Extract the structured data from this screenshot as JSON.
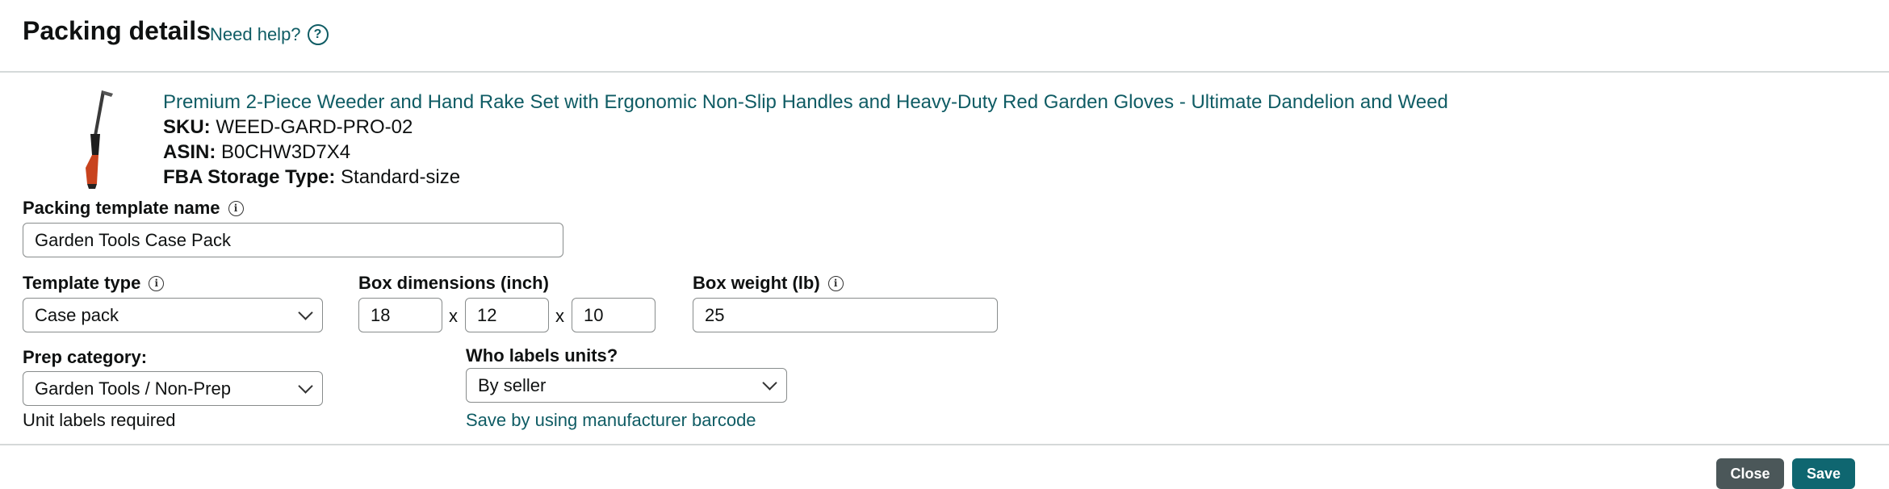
{
  "header": {
    "title": "Packing details",
    "help_label": "Need help?",
    "help_icon": "question-circle-icon"
  },
  "product": {
    "name": "Premium 2-Piece Weeder and Hand Rake Set with Ergonomic Non-Slip Handles and Heavy-Duty Red Garden Gloves - Ultimate Dandelion and Weed",
    "sku_label": "SKU:",
    "sku": "WEED-GARD-PRO-02",
    "asin_label": "ASIN:",
    "asin": "B0CHW3D7X4",
    "storage_label": "FBA Storage Type:",
    "storage": "Standard-size"
  },
  "form": {
    "template_name_label": "Packing template name",
    "template_name_value": "Garden Tools Case Pack",
    "template_type_label": "Template type",
    "template_type_value": "Case pack",
    "box_dimensions_label": "Box dimensions (inch)",
    "box_length": "18",
    "box_width": "12",
    "box_height": "10",
    "dim_separator": "x",
    "box_weight_label": "Box weight (lb)",
    "box_weight_value": "25",
    "prep_category_label": "Prep category:",
    "prep_category_value": "Garden Tools / Non-Prep",
    "unit_labels_note": "Unit labels required",
    "who_labels_label": "Who labels units?",
    "who_labels_value": "By seller",
    "barcode_link": "Save by using manufacturer barcode"
  },
  "footer": {
    "close_label": "Close",
    "save_label": "Save"
  },
  "colors": {
    "link": "#0f5c64",
    "close_button": "#4b5759",
    "save_button": "#0f6670",
    "border": "#d5d9d9"
  }
}
